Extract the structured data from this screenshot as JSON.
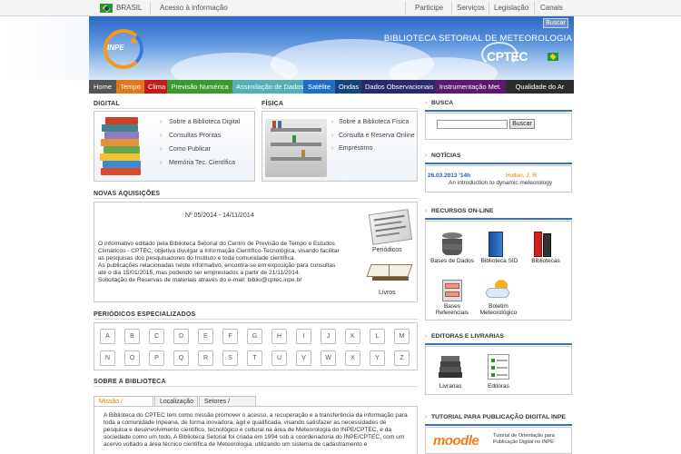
{
  "govbar": {
    "country": "BRASIL",
    "access": "Acesso à informação",
    "links": [
      "Participe",
      "Serviços",
      "Legislação",
      "Canais"
    ]
  },
  "header": {
    "search_button": "Buscar",
    "title": "BIBLIOTECA SETORIAL DE METEOROLOGIA",
    "brand": "CPTEC",
    "logo_text": "INPE"
  },
  "menu": [
    {
      "label": "Home",
      "color": "#555555"
    },
    {
      "label": "Tempo",
      "color": "#e2761a"
    },
    {
      "label": "Clima",
      "color": "#c41a1a"
    },
    {
      "label": "Previsão Numérica",
      "color": "#3b9a2c"
    },
    {
      "label": "Assimilação de Dados",
      "color": "#53b0b4"
    },
    {
      "label": "Satélite",
      "color": "#1f6fc4"
    },
    {
      "label": "Ondas",
      "color": "#14467a"
    },
    {
      "label": "Dados Observacionais",
      "color": "#2a2a6a"
    },
    {
      "label": "Instrumentação Met.",
      "color": "#5b1a6e"
    },
    {
      "label": "Qualidade do Ar",
      "color": "#2c2c2c"
    }
  ],
  "digital": {
    "heading": "DIGITAL",
    "links": [
      "Sobre a Biblioteca Digital",
      "Consultas Prontas",
      "Como Publicar",
      "Memória Tec. Científica"
    ]
  },
  "fisica": {
    "heading": "FÍSICA",
    "links": [
      "Sobre a Biblioteca Física",
      "Consulta e Reserva Online",
      "Empréstimo"
    ]
  },
  "novas": {
    "heading": "NOVAS AQUISIÇÕES",
    "issue": "Nº 05/2014 - 14/11/2014",
    "lines": [
      "O informativo editado pela Biblioteca Setorial do Centro de Previsão de Tempo e Estudos",
      "Climáticos - CPTEC, objetiva divulgar a Informação Científico-Tecnológica, visando facilitar",
      "as pesquisas dos pesquisadores do Instituto e toda comunidade científica.",
      "As publicações relacionadas neste informativo, encontra-se em exposição para consultas",
      "até o dia 15/01/2015, mas podendo ser emprestados a partir de 21/11/2014.",
      "Solicitação de Reservas de materiais através do e-mail: biblio@cptec.inpe.br"
    ],
    "icon_periodicos": "Periódicos",
    "icon_livros": "Livros"
  },
  "periodicos": {
    "heading": "PERIÓDICOS ESPECIALIZADOS",
    "row1": [
      "A",
      "B",
      "C",
      "D",
      "E",
      "F",
      "G",
      "H",
      "I",
      "J",
      "K",
      "L",
      "M"
    ],
    "row2": [
      "N",
      "O",
      "P",
      "Q",
      "R",
      "S",
      "T",
      "U",
      "V",
      "W",
      "X",
      "Y",
      "Z"
    ]
  },
  "sobre": {
    "heading": "SOBRE A BIBLIOTECA",
    "tabs": [
      "Missão / Histórico",
      "Localização",
      "Setores / Contato"
    ],
    "lines": [
      "A Biblioteca do CPTEC tem como missão promover o acesso, a recuperação e a transferência da informação para",
      "toda a comunidade Inpeana, de forma inovadora, ágil e qualificada, visando satisfazer as necessidades de",
      "pesquisa e desenvolvimento científico, tecnológico e cultural na área de Meteorologia do INPE/CPTEC, e da",
      "sociedade como um todo. A Biblioteca Setorial foi criada em 1994 sob a coordenadoria do INPE/CPTEC, com um",
      "acervo voltado a área técnico científica de Meteorologia, utilizando um sistema de cadastramento e"
    ]
  },
  "busca": {
    "heading": "BUSCA",
    "input_value": "",
    "button": "Buscar"
  },
  "noticias": {
    "heading": "NOTÍCIAS",
    "date": "26.03.2013 '14h",
    "author": "Holton, J. R.",
    "title": "An introduction to dynamic meteorology"
  },
  "recursos": {
    "heading": "RECURSOS ON-LINE",
    "items": [
      "Bases de Dados",
      "Biblioteca SID",
      "Bibliotecas",
      "Bases Referenciais",
      "Boletim Meteorológico"
    ]
  },
  "editoras": {
    "heading": "EDITORAS E LIVRARIAS",
    "items": [
      "Livrarias",
      "Editoras"
    ]
  },
  "tutorial": {
    "heading": "TUTORIAL PARA PUBLICAÇÃO DIGITAL INPE",
    "logo": "moodle",
    "text": "Tutorial de Orientação para Publicação Digital no INPE"
  },
  "colors": {
    "accent_orange": "#e07b00",
    "brand_blue": "#3b6fb6"
  }
}
